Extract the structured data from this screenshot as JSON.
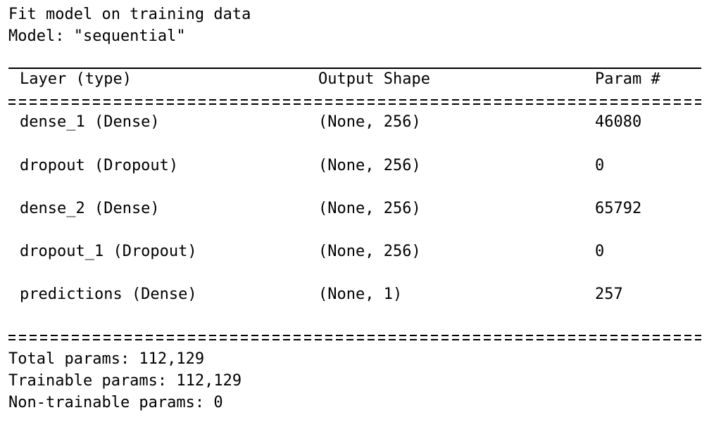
{
  "header": {
    "line1": "Fit model on training data",
    "line2": "Model: \"sequential\""
  },
  "table": {
    "columns": [
      "Layer (type)",
      "Output Shape",
      "Param #"
    ],
    "rows": [
      {
        "layer": "dense_1 (Dense)",
        "shape": "(None, 256)",
        "params": "46080"
      },
      {
        "layer": "dropout (Dropout)",
        "shape": "(None, 256)",
        "params": "0"
      },
      {
        "layer": "dense_2 (Dense)",
        "shape": "(None, 256)",
        "params": "65792"
      },
      {
        "layer": "dropout_1 (Dropout)",
        "shape": "(None, 256)",
        "params": "0"
      },
      {
        "layer": "predictions (Dense)",
        "shape": "(None, 1)",
        "params": "257"
      }
    ]
  },
  "summary": {
    "total": "Total params: 112,129",
    "trainable": "Trainable params: 112,129",
    "non_trainable": "Non-trainable params: 0"
  }
}
